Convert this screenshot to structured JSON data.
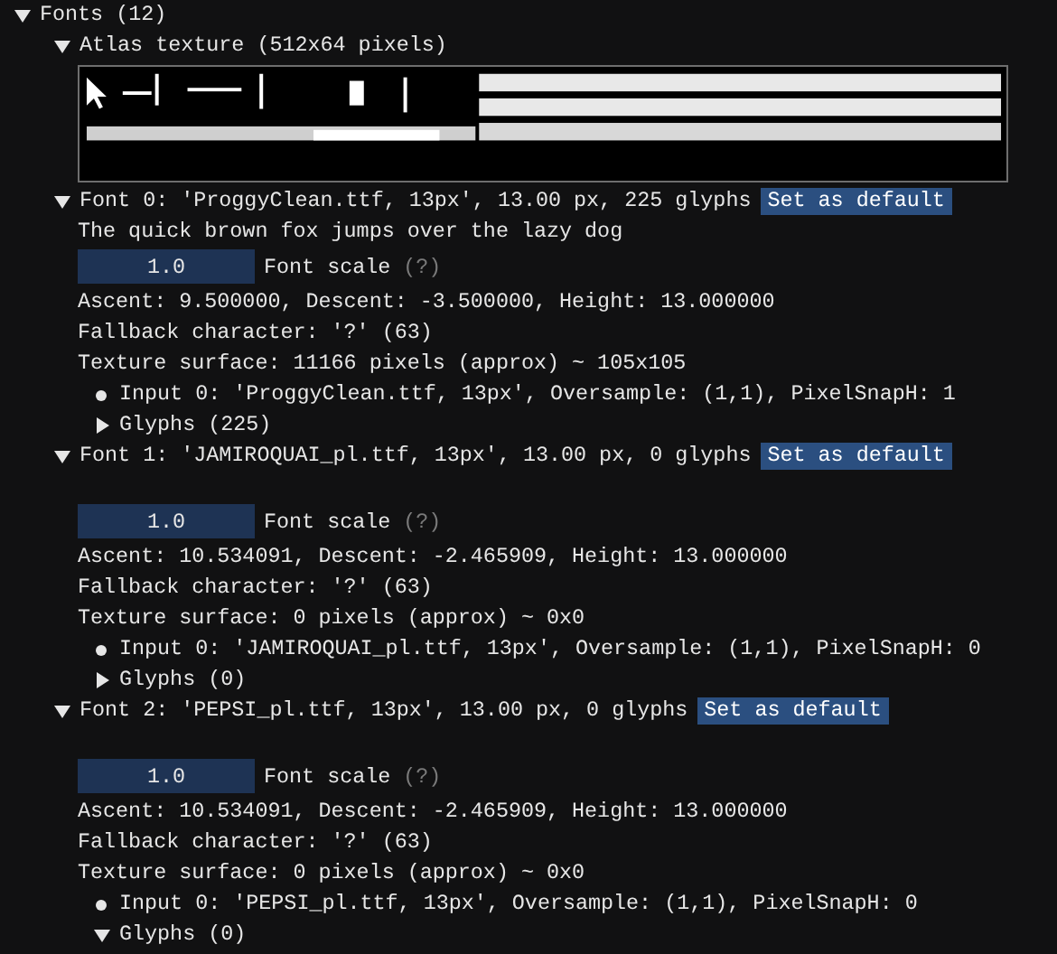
{
  "tree": {
    "label": "Fonts (12)",
    "expanded": true,
    "atlas": {
      "label": "Atlas texture (512x64 pixels)",
      "expanded": true
    },
    "fonts": [
      {
        "label": "Font 0: 'ProggyClean.ttf, 13px', 13.00 px, 225 glyphs",
        "expanded": true,
        "button": "Set as default",
        "sample": "The quick brown fox jumps over the lazy dog",
        "scale_value": "1.0",
        "scale_label": "Font scale",
        "help": "(?)",
        "metrics": "Ascent: 9.500000, Descent: -3.500000, Height: 13.000000",
        "fallback": "Fallback character: '?' (63)",
        "surface": "Texture surface: 11166 pixels (approx) ~ 105x105",
        "inputs": [
          "Input 0: 'ProggyClean.ttf, 13px', Oversample: (1,1), PixelSnapH: 1"
        ],
        "glyphs": {
          "label": "Glyphs (225)",
          "expanded": false
        }
      },
      {
        "label": "Font 1: 'JAMIROQUAI_pl.ttf, 13px', 13.00 px, 0 glyphs",
        "expanded": true,
        "button": "Set as default",
        "scale_value": "1.0",
        "scale_label": "Font scale",
        "help": "(?)",
        "metrics": "Ascent: 10.534091, Descent: -2.465909, Height: 13.000000",
        "fallback": "Fallback character: '?' (63)",
        "surface": "Texture surface: 0 pixels (approx) ~ 0x0",
        "inputs": [
          "Input 0: 'JAMIROQUAI_pl.ttf, 13px', Oversample: (1,1), PixelSnapH: 0"
        ],
        "glyphs": {
          "label": "Glyphs (0)",
          "expanded": false
        }
      },
      {
        "label": "Font 2: 'PEPSI_pl.ttf, 13px', 13.00 px, 0 glyphs",
        "expanded": true,
        "button": "Set as default",
        "scale_value": "1.0",
        "scale_label": "Font scale",
        "help": "(?)",
        "metrics": "Ascent: 10.534091, Descent: -2.465909, Height: 13.000000",
        "fallback": "Fallback character: '?' (63)",
        "surface": "Texture surface: 0 pixels (approx) ~ 0x0",
        "inputs": [
          "Input 0: 'PEPSI_pl.ttf, 13px', Oversample: (1,1), PixelSnapH: 0"
        ],
        "glyphs": {
          "label": "Glyphs (0)",
          "expanded": true
        }
      }
    ]
  }
}
